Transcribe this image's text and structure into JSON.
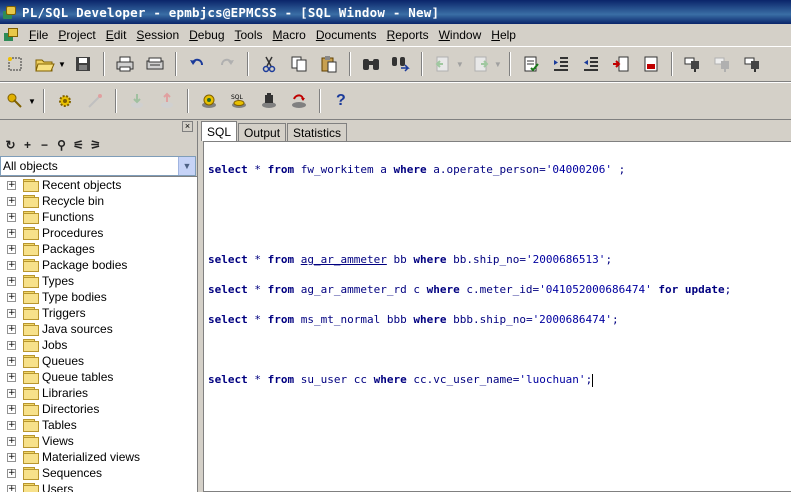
{
  "window": {
    "title": "PL/SQL Developer - epmbjcs@EPMCSS - [SQL Window - New]"
  },
  "menu": [
    "File",
    "Project",
    "Edit",
    "Session",
    "Debug",
    "Tools",
    "Macro",
    "Documents",
    "Reports",
    "Window",
    "Help"
  ],
  "toolbar1": [
    "new-icon",
    "open-icon",
    "save-icon",
    "print-icon",
    "print-preview-icon",
    "undo-icon",
    "redo-icon",
    "cut-icon",
    "copy-icon",
    "paste-icon",
    "find-icon",
    "find-replace-icon",
    "back-icon",
    "forward-icon",
    "comment-icon",
    "indent-icon",
    "unindent-icon",
    "fullscreen-icon",
    "record-icon",
    "new-sql-icon",
    "exec-icon",
    "next-icon"
  ],
  "toolbar2": [
    "key-icon",
    "gear-icon",
    "wand-icon",
    "download-icon",
    "upload-icon",
    "db-connect-icon",
    "sql-icon",
    "commit-icon",
    "rollback-icon",
    "help-icon"
  ],
  "left_panel": {
    "filter": "All objects",
    "tree": [
      "Recent objects",
      "Recycle bin",
      "Functions",
      "Procedures",
      "Packages",
      "Package bodies",
      "Types",
      "Type bodies",
      "Triggers",
      "Java sources",
      "Jobs",
      "Queues",
      "Queue tables",
      "Libraries",
      "Directories",
      "Tables",
      "Views",
      "Materialized views",
      "Sequences",
      "Users"
    ]
  },
  "tabs": [
    "SQL",
    "Output",
    "Statistics"
  ],
  "active_tab": "SQL",
  "sql": {
    "line1": {
      "kw1": "select",
      "star": " * ",
      "kw2": "from",
      "rest": " fw_workitem a ",
      "kw3": "where",
      "cond": " a.operate_person=",
      "val": "'04000206'",
      "tail": " ;"
    },
    "line2": {
      "kw1": "select",
      "star": " * ",
      "kw2": "from",
      "table": "ag_ar_ammeter",
      "rest": " bb ",
      "kw3": "where",
      "cond": " bb.ship_no=",
      "val": "'2000686513'",
      "tail": ";"
    },
    "line3": {
      "kw1": "select",
      "star": " * ",
      "kw2": "from",
      "rest": " ag_ar_ammeter_rd c ",
      "kw3": "where",
      "cond": " c.meter_id=",
      "val": "'041052000686474'",
      "kw4": " for update",
      "tail": ";"
    },
    "line4": {
      "kw1": "select",
      "star": " * ",
      "kw2": "from",
      "rest": " ms_mt_normal bbb ",
      "kw3": "where",
      "cond": " bbb.ship_no=",
      "val": "'2000686474'",
      "tail": ";"
    },
    "line5": {
      "kw1": "select",
      "star": " * ",
      "kw2": "from",
      "rest": " su_user cc ",
      "kw3": "where",
      "cond": " cc.vc_user_name=",
      "val": "'luochuan'",
      "tail": ";"
    }
  }
}
